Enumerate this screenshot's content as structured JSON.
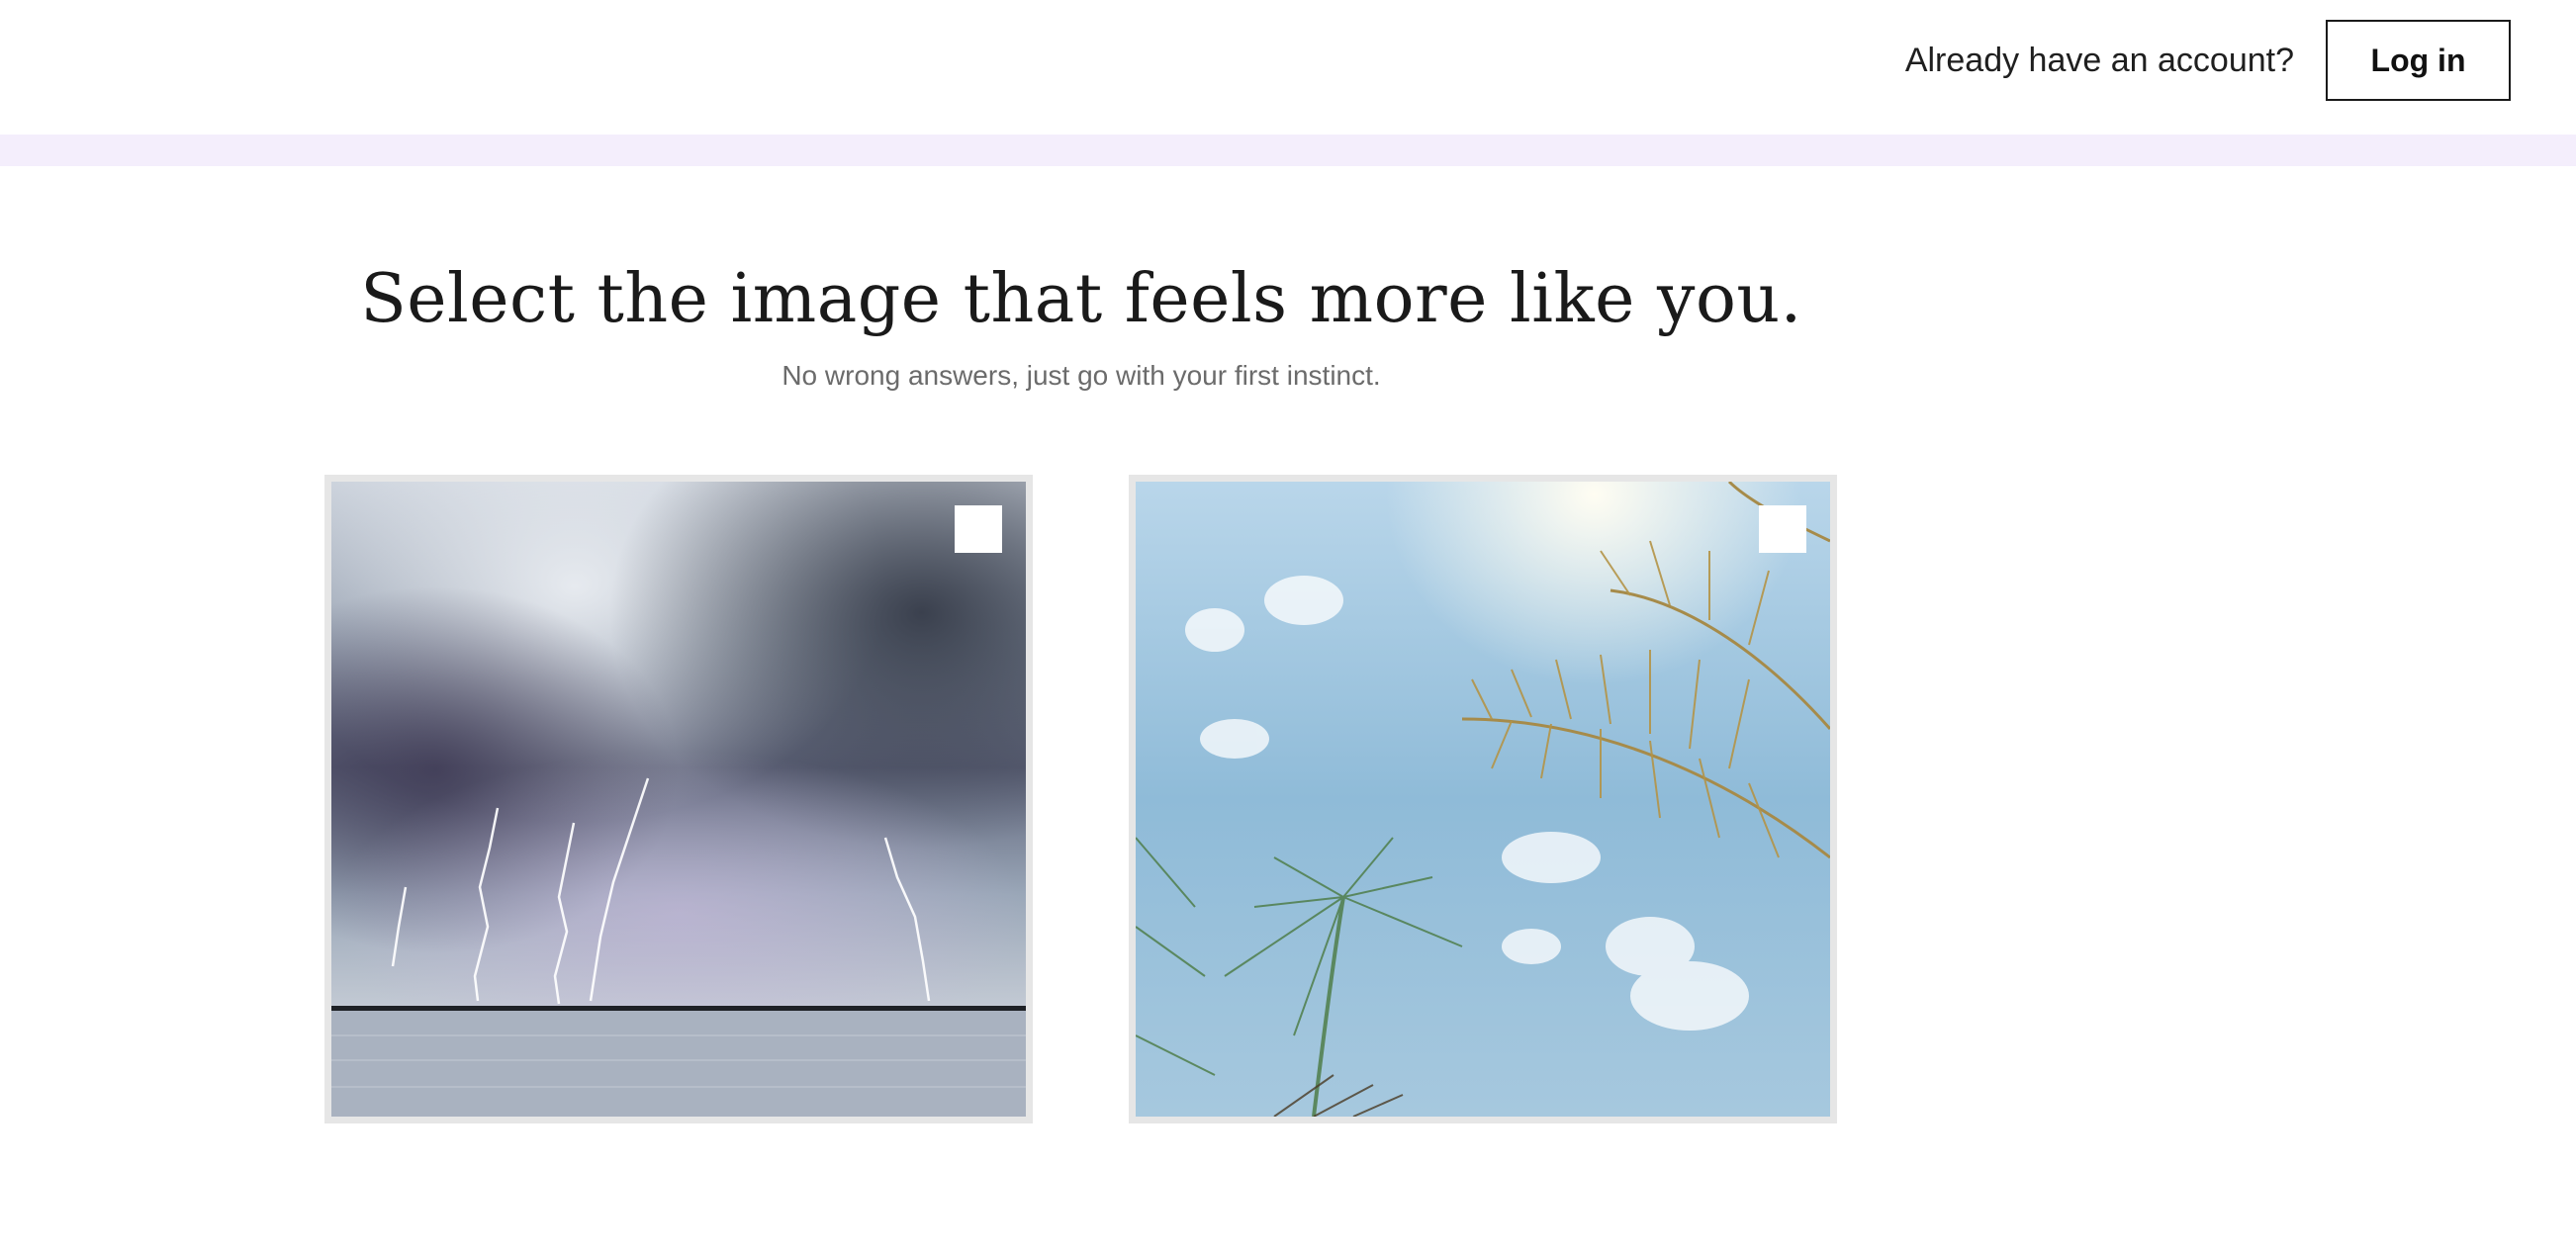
{
  "header": {
    "prompt": "Already have an account?",
    "login_label": "Log in"
  },
  "main": {
    "title": "Select the image that feels more like you.",
    "subtitle": "No wrong answers, just go with your first instinct."
  },
  "options": [
    {
      "image": "storm-lightning-over-water",
      "selected": false
    },
    {
      "image": "palm-trees-against-sky",
      "selected": false
    }
  ],
  "colors": {
    "band": "#f4eefc",
    "card_border": "#e6e6e6",
    "text": "#1a1a1a",
    "muted": "#6b6b6b"
  }
}
